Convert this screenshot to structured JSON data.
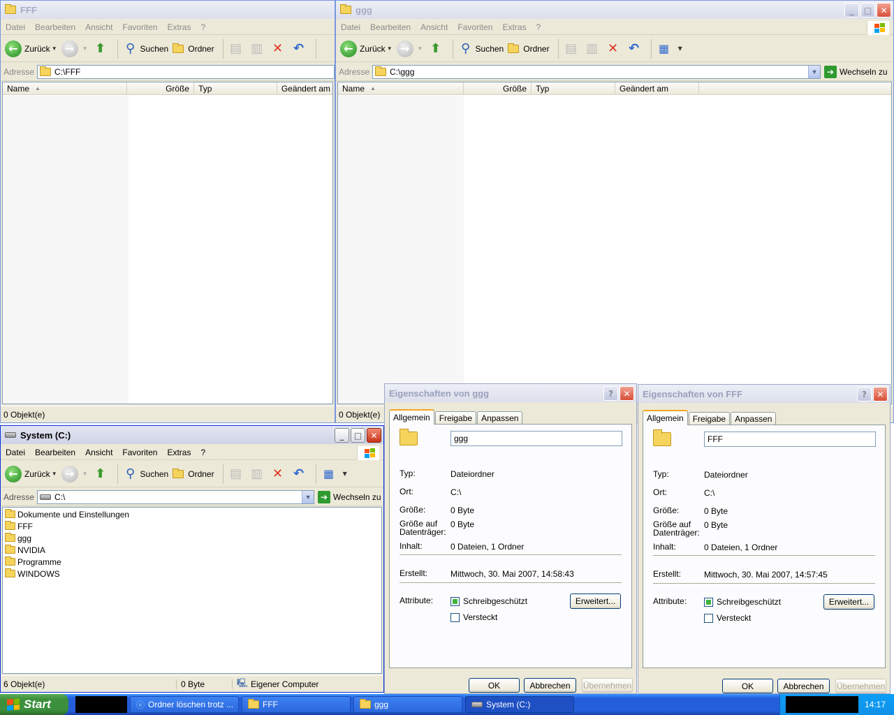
{
  "menus": [
    "Datei",
    "Bearbeiten",
    "Ansicht",
    "Favoriten",
    "Extras",
    "?"
  ],
  "toolbar": {
    "back": "Zurück",
    "search": "Suchen",
    "folders": "Ordner",
    "go": "Wechseln zu",
    "address_label": "Adresse"
  },
  "win_fff": {
    "title": "FFF",
    "address": "C:\\FFF",
    "status": "0 Objekt(e)"
  },
  "win_ggg": {
    "title": "ggg",
    "address": "C:\\ggg",
    "status": "0 Objekt(e)"
  },
  "columns": {
    "name": "Name",
    "size": "Größe",
    "type": "Typ",
    "modified": "Geändert am"
  },
  "win_system": {
    "title": "System (C:)",
    "address": "C:\\",
    "items": [
      "Dokumente und Einstellungen",
      "FFF",
      "ggg",
      "NVIDIA",
      "Programme",
      "WINDOWS"
    ],
    "status_count": "6 Objekt(e)",
    "status_size": "0 Byte",
    "status_location": "Eigener Computer"
  },
  "dialog_labels": {
    "tabs": [
      "Allgemein",
      "Freigabe",
      "Anpassen"
    ],
    "type": "Typ:",
    "location": "Ort:",
    "size": "Größe:",
    "size_on_disk": "Größe auf Datenträger:",
    "contents": "Inhalt:",
    "created": "Erstellt:",
    "attributes": "Attribute:",
    "readonly": "Schreibgeschützt",
    "hidden": "Versteckt",
    "advanced": "Erweitert...",
    "ok": "OK",
    "cancel": "Abbrechen",
    "apply": "Übernehmen"
  },
  "dlg_ggg": {
    "title": "Eigenschaften von ggg",
    "name": "ggg",
    "type": "Dateiordner",
    "location": "C:\\",
    "size": "0 Byte",
    "size_on_disk": "0 Byte",
    "contents": "0 Dateien, 1 Ordner",
    "created": "Mittwoch, 30. Mai 2007, 14:58:43"
  },
  "dlg_fff": {
    "title": "Eigenschaften von FFF",
    "name": "FFF",
    "type": "Dateiordner",
    "location": "C:\\",
    "size": "0 Byte",
    "size_on_disk": "0 Byte",
    "contents": "0 Dateien, 1 Ordner",
    "created": "Mittwoch, 30. Mai 2007, 14:57:45"
  },
  "taskbar": {
    "start": "Start",
    "items": [
      "Ordner löschen trotz ...",
      "FFF",
      "ggg",
      "System (C:)"
    ],
    "clock": "14:17"
  }
}
